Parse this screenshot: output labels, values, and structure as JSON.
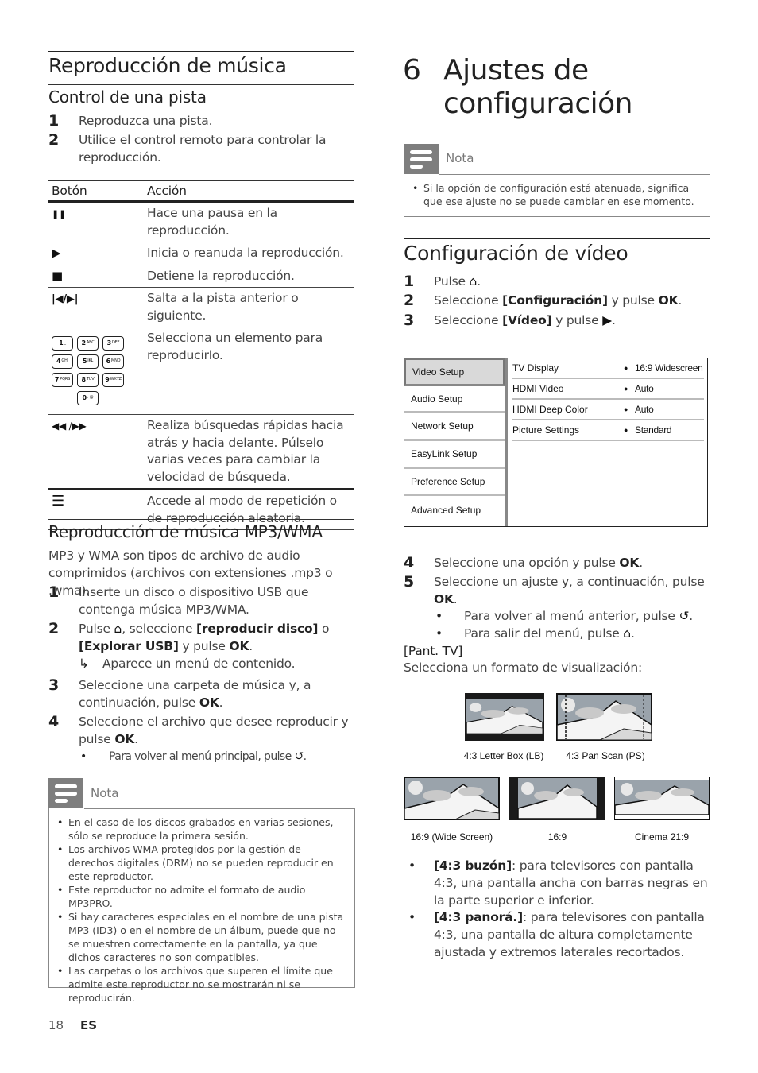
{
  "left": {
    "section_title": "Reproducción de música",
    "subsection_track": "Control de una pista",
    "track_steps": [
      {
        "num": "1",
        "text": "Reproduzca una pista."
      },
      {
        "num": "2",
        "text": "Utilice el control remoto para controlar la reproducción."
      }
    ],
    "table": {
      "headers": [
        "Botón",
        "Acción"
      ],
      "rows": [
        {
          "icon": "pause-icon",
          "glyph": "❚❚",
          "action": "Hace una pausa en la reproducción."
        },
        {
          "icon": "play-icon",
          "glyph": "▶",
          "action": "Inicia o reanuda la reproducción."
        },
        {
          "icon": "stop-icon",
          "glyph": "■",
          "action": "Detiene la reproducción."
        },
        {
          "icon": "prev-next-icon",
          "glyph": "|◀/▶|",
          "action": "Salta a la pista anterior o siguiente."
        },
        {
          "icon": "numeric-keypad-icon",
          "glyph": "",
          "action": "Selecciona un elemento para reproducirlo."
        },
        {
          "icon": "rewind-fastforward-icon",
          "glyph": "◀◀ /▶▶",
          "action": "Realiza búsquedas rápidas hacia atrás y hacia delante. Púlselo varias veces para cambiar la velocidad de búsqueda."
        },
        {
          "icon": "repeat-menu-icon",
          "glyph": "☰",
          "action": "Accede al modo de repetición o de reproducción aleatoria."
        }
      ],
      "keypad_keys": [
        {
          "d": "1",
          "l": "_"
        },
        {
          "d": "2",
          "l": "ABC"
        },
        {
          "d": "3",
          "l": "DEF"
        },
        {
          "d": "4",
          "l": "GHI"
        },
        {
          "d": "5",
          "l": "JKL"
        },
        {
          "d": "6",
          "l": "MNO"
        },
        {
          "d": "7",
          "l": "PQRS"
        },
        {
          "d": "8",
          "l": "TUV"
        },
        {
          "d": "9",
          "l": "WXYZ"
        },
        {
          "d": "0",
          "l": ". @"
        }
      ]
    },
    "subsection_mp3": "Reproducción de música MP3/WMA",
    "mp3_intro": "MP3 y WMA son tipos de archivo de audio comprimidos (archivos con extensiones .mp3 o .wma).",
    "mp3_steps": {
      "s1": {
        "num": "1",
        "text": "Inserte un disco o dispositivo USB que contenga música MP3/WMA."
      },
      "s2": {
        "num": "2",
        "pre": "Pulse ",
        "mid1": ", seleccione ",
        "opt1": "[reproducir disco]",
        "mid2": " o ",
        "opt2": "[Explorar USB]",
        "mid3": " y pulse ",
        "ok": "OK",
        "end": ".",
        "result": "Aparece un menú de contenido."
      },
      "s3": {
        "num": "3",
        "pre": "Seleccione una carpeta de música y, a continuación, pulse ",
        "ok": "OK",
        "end": "."
      },
      "s4": {
        "num": "4",
        "pre": "Seleccione el archivo que desee reproducir y pulse ",
        "ok": "OK",
        "end": ".",
        "bullet": "Para volver al menú principal, pulse"
      }
    },
    "note": {
      "label": "Nota",
      "items": [
        "En el caso de los discos grabados en varias sesiones, sólo se reproduce la primera sesión.",
        "Los archivos WMA protegidos por la gestión de derechos digitales (DRM) no se pueden reproducir en este reproductor.",
        "Este reproductor no admite el formato de audio MP3PRO.",
        "Si hay caracteres especiales en el nombre de una pista MP3 (ID3) o en el nombre de un álbum, puede que no se muestren correctamente en la pantalla, ya que dichos caracteres no son compatibles.",
        "Las carpetas o los archivos que superen el límite que admite este reproductor no se mostrarán ni se reproducirán."
      ]
    }
  },
  "right": {
    "chapter_num": "6",
    "chapter_title_l1": "Ajustes de",
    "chapter_title_l2": "configuración",
    "note": {
      "label": "Nota",
      "text": "Si la opción de configuración está atenuada, significa que ese ajuste no se puede cambiar en ese momento."
    },
    "section_title": "Configuración de vídeo",
    "steps": {
      "s1": {
        "num": "1",
        "pre": "Pulse ",
        "end": "."
      },
      "s2": {
        "num": "2",
        "pre": "Seleccione ",
        "opt": "[Configuración]",
        "mid": " y pulse ",
        "ok": "OK",
        "end": "."
      },
      "s3": {
        "num": "3",
        "pre": "Seleccione ",
        "opt": "[Vídeo]",
        "mid": " y pulse ",
        "end": "."
      },
      "s4": {
        "num": "4",
        "pre": "Seleccione una opción y pulse ",
        "ok": "OK",
        "end": "."
      },
      "s5": {
        "num": "5",
        "pre": "Seleccione un ajuste y, a continuación, pulse ",
        "ok": "OK",
        "end": ".",
        "b1": "Para volver al menú anterior, pulse",
        "b2": "Para salir del menú, pulse"
      }
    },
    "menu": {
      "left_items": [
        "Video Setup",
        "Audio Setup",
        "Network Setup",
        "EasyLink Setup",
        "Preference Setup",
        "Advanced Setup"
      ],
      "selected_index": 0,
      "rows": [
        {
          "key": "TV Display",
          "value": "16:9 Widescreen"
        },
        {
          "key": "HDMI Video",
          "value": "Auto"
        },
        {
          "key": "HDMI Deep Color",
          "value": "Auto"
        },
        {
          "key": "Picture Settings",
          "value": "Standard"
        }
      ]
    },
    "pant_tv_label": "[Pant. TV]",
    "pant_tv_desc": "Selecciona un formato de visualización:",
    "formats": [
      "4:3 Letter Box (LB)",
      "4:3 Pan Scan (PS)",
      "16:9 (Wide Screen)",
      "16:9",
      "Cinema 21:9"
    ],
    "bullets": [
      {
        "opt": "[4:3 buzón]",
        "text": ": para televisores con pantalla 4:3, una pantalla ancha con barras negras en la parte superior e inferior."
      },
      {
        "opt": "[4:3 panorá.]",
        "text": ": para televisores con pantalla 4:3, una pantalla de altura completamente ajustada y extremos laterales recortados."
      }
    ]
  },
  "footer": {
    "page": "18",
    "lang": "ES"
  }
}
